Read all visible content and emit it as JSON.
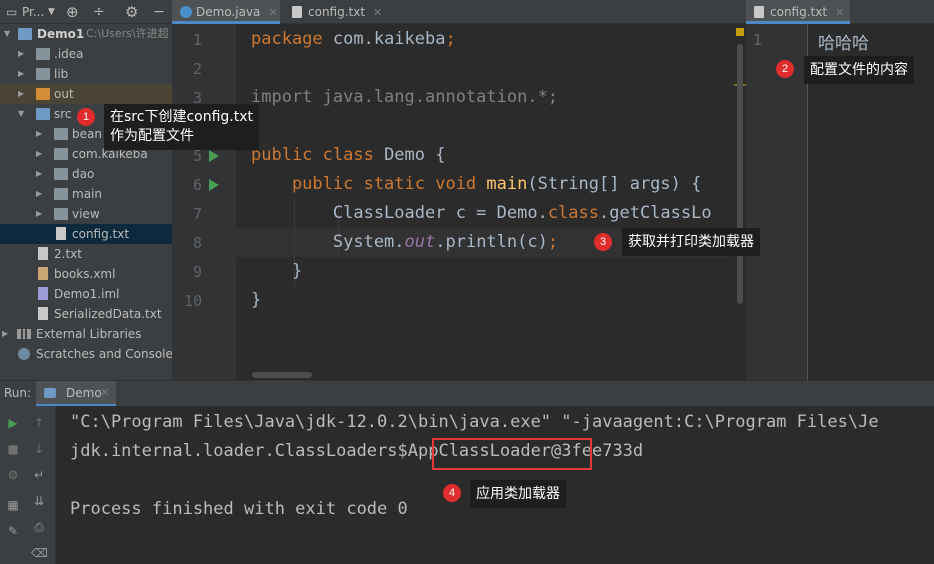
{
  "project_toolbar": {
    "title": "Pr...",
    "icons": [
      "dropdown-icon",
      "target-icon",
      "collapse-icon",
      "gear-icon",
      "minimize-icon"
    ]
  },
  "project_tree": [
    {
      "label": "Demo1",
      "extra": "C:\\Users\\许进超",
      "level": 0,
      "type": "module",
      "expanded": true
    },
    {
      "label": ".idea",
      "level": 1,
      "type": "folder",
      "expanded": false
    },
    {
      "label": "lib",
      "level": 1,
      "type": "folder",
      "expanded": false
    },
    {
      "label": "out",
      "level": 1,
      "type": "folder-orange",
      "expanded": false
    },
    {
      "label": "src",
      "level": 1,
      "type": "folder-blue",
      "expanded": true
    },
    {
      "label": "bean",
      "level": 2,
      "type": "package",
      "expanded": false
    },
    {
      "label": "com.kaikeba",
      "level": 2,
      "type": "package",
      "expanded": false
    },
    {
      "label": "dao",
      "level": 2,
      "type": "package",
      "expanded": false
    },
    {
      "label": "main",
      "level": 2,
      "type": "package",
      "expanded": false
    },
    {
      "label": "view",
      "level": 2,
      "type": "package",
      "expanded": false
    },
    {
      "label": "config.txt",
      "level": 2,
      "type": "file",
      "selected": true
    },
    {
      "label": "2.txt",
      "level": 1,
      "type": "file"
    },
    {
      "label": "books.xml",
      "level": 1,
      "type": "xml"
    },
    {
      "label": "Demo1.iml",
      "level": 1,
      "type": "iml"
    },
    {
      "label": "SerializedData.txt",
      "level": 1,
      "type": "file"
    },
    {
      "label": "External Libraries",
      "level": 0,
      "type": "libraries",
      "expanded": false
    },
    {
      "label": "Scratches and Consoles",
      "level": 0,
      "type": "scratches"
    }
  ],
  "editor_tabs": [
    {
      "label": "Demo.java",
      "active": true
    },
    {
      "label": "config.txt",
      "active": false
    }
  ],
  "right_tabs": [
    {
      "label": "config.txt",
      "active": true
    }
  ],
  "code_lines": [
    {
      "n": "1",
      "text": "package com.kaikeba;"
    },
    {
      "n": "2",
      "text": ""
    },
    {
      "n": "3",
      "text": "import java.lang.annotation.*;"
    },
    {
      "n": "4",
      "text": ""
    },
    {
      "n": "5",
      "text": "public class Demo {"
    },
    {
      "n": "6",
      "text": "    public static void main(String[] args) {"
    },
    {
      "n": "7",
      "text": "        ClassLoader c = Demo.class.getClassLo"
    },
    {
      "n": "8",
      "text": "        System.out.println(c);"
    },
    {
      "n": "9",
      "text": "    }"
    },
    {
      "n": "10",
      "text": "}"
    }
  ],
  "right_editor": {
    "line_number": "1",
    "content": "哈哈哈"
  },
  "run_panel": {
    "label": "Run:",
    "tab": "Demo"
  },
  "console_lines": [
    "\"C:\\Program Files\\Java\\jdk-12.0.2\\bin\\java.exe\" \"-javaagent:C:\\Program Files\\Je",
    "jdk.internal.loader.ClassLoaders$AppClassLoader@3fee733d",
    "",
    "Process finished with exit code 0"
  ],
  "annotations": [
    {
      "num": "1",
      "text": "在src下创建config.txt\n作为配置文件"
    },
    {
      "num": "2",
      "text": "配置文件的内容"
    },
    {
      "num": "3",
      "text": "获取并打印类加载器"
    },
    {
      "num": "4",
      "text": "应用类加载器"
    }
  ],
  "colors": {
    "keyword": "#cc7832",
    "method": "#ffc66d",
    "static_field": "#9876aa",
    "annotation_badge": "#e02c2c",
    "highlight_box": "#e53935"
  }
}
